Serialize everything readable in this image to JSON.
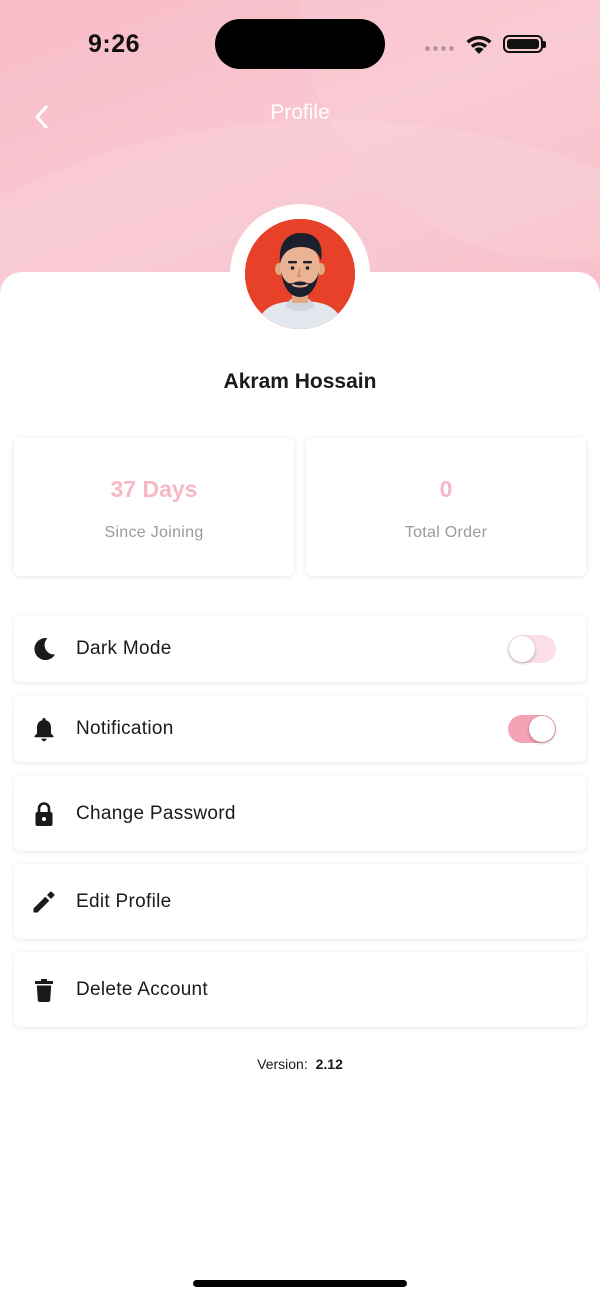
{
  "status_bar": {
    "time": "9:26"
  },
  "header": {
    "title": "Profile",
    "back_icon": "chevron-left-icon"
  },
  "profile": {
    "name": "Akram Hossain",
    "avatar_icon": "user-avatar"
  },
  "stats": [
    {
      "value": "37 Days",
      "label": "Since Joining"
    },
    {
      "value": "0",
      "label": "Total Order"
    }
  ],
  "menu": {
    "dark_mode": {
      "label": "Dark Mode",
      "icon": "moon-icon",
      "enabled": false
    },
    "notification": {
      "label": "Notification",
      "icon": "bell-icon",
      "enabled": true
    },
    "change_password": {
      "label": "Change Password",
      "icon": "lock-icon"
    },
    "edit_profile": {
      "label": "Edit Profile",
      "icon": "pencil-icon"
    },
    "delete_account": {
      "label": "Delete Account",
      "icon": "trash-icon"
    }
  },
  "footer": {
    "version_label": "Version:",
    "version_value": "2.12"
  },
  "colors": {
    "accent": "#f7b8c6",
    "toggle_on": "#f4a3b6",
    "toggle_off": "#fbe1e7",
    "header_bg": "#f9c3ce",
    "avatar_bg": "#e8412a"
  }
}
